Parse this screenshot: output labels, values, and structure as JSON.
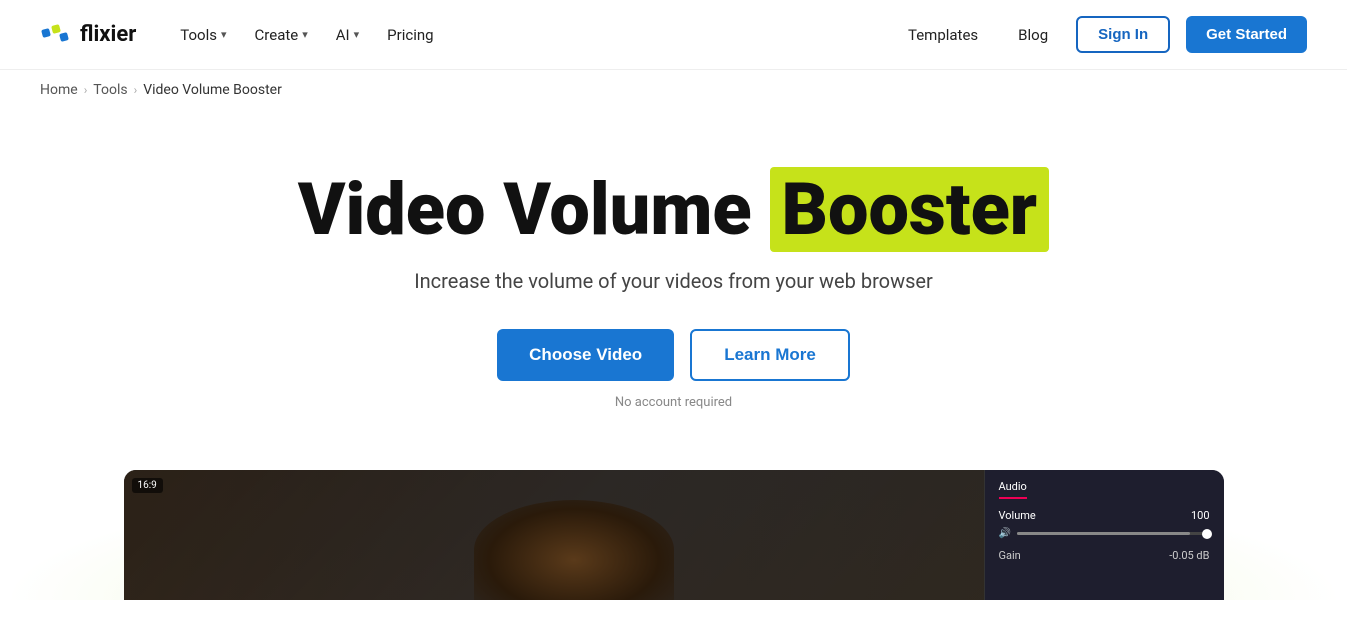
{
  "brand": {
    "name": "flixier",
    "logo_icon_color1": "#1976d2",
    "logo_icon_color2": "#c6e21a"
  },
  "nav": {
    "tools_label": "Tools",
    "create_label": "Create",
    "ai_label": "AI",
    "pricing_label": "Pricing",
    "templates_label": "Templates",
    "blog_label": "Blog",
    "signin_label": "Sign In",
    "getstarted_label": "Get Started"
  },
  "breadcrumb": {
    "home": "Home",
    "tools": "Tools",
    "current": "Video Volume Booster"
  },
  "hero": {
    "title_part1": "Video Volume",
    "title_highlight": "Booster",
    "subtitle": "Increase the volume of your videos from your web browser",
    "cta_primary": "Choose Video",
    "cta_secondary": "Learn More",
    "no_account": "No account required"
  },
  "video_preview": {
    "aspect": "16:9",
    "panel_tab": "Audio",
    "volume_label": "Volume",
    "volume_value": "100",
    "gain_label": "Gain",
    "gain_value": "-0.05 dB"
  }
}
